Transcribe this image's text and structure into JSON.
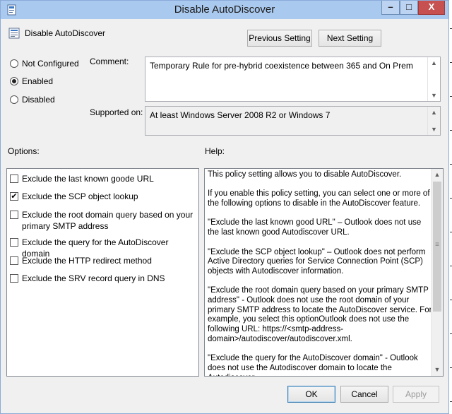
{
  "window": {
    "title": "Disable AutoDiscover",
    "minimize_glyph": "–",
    "maximize_glyph": "□",
    "close_glyph": "X"
  },
  "header": {
    "policy_title": "Disable AutoDiscover",
    "previous_label": "Previous Setting",
    "next_label": "Next Setting"
  },
  "state": {
    "options": [
      {
        "label": "Not Configured",
        "selected": false
      },
      {
        "label": "Enabled",
        "selected": true
      },
      {
        "label": "Disabled",
        "selected": false
      }
    ]
  },
  "comment": {
    "label": "Comment:",
    "value": "Temporary Rule for pre-hybrid coexistence between 365 and On Prem"
  },
  "supported": {
    "label": "Supported on:",
    "value": "At least Windows Server 2008 R2 or Windows 7"
  },
  "options_label": "Options:",
  "help_label": "Help:",
  "options": [
    {
      "label": "Exclude the last known goode URL",
      "checked": false
    },
    {
      "label": "Exclude the SCP object lookup",
      "checked": true
    },
    {
      "label": "Exclude the root domain query based on your primary SMTP address",
      "checked": false
    },
    {
      "label": "Exclude the query for the AutoDiscover domain",
      "checked": false
    },
    {
      "label": "Exclude the HTTP redirect method",
      "checked": false
    },
    {
      "label": "Exclude the SRV record query in DNS",
      "checked": false
    }
  ],
  "help": {
    "paragraphs": [
      "This policy setting allows you to disable AutoDiscover.",
      "If you enable this policy setting, you can select one or more of the following options to disable in the AutoDiscover feature.",
      "\"Exclude the last known good URL\" – Outlook does not use the last known good Autodiscover URL.",
      "\"Exclude the SCP object lookup\" – Outlook does not perform Active Directory queries for Service Connection Point (SCP) objects with Autodiscover information.",
      "\"Exclude the root domain query based on your primary SMTP address\" - Outlook does not use the root domain of your primary SMTP address to locate the AutoDiscover service. For example, you select this optionOutlook does not use the following URL: https://<smtp-address-domain>/autodiscover/autodiscover.xml.",
      "\"Exclude the query for the AutoDiscover domain\" - Outlook does not use the Autodiscover domain to locate the Autodiscover"
    ]
  },
  "footer": {
    "ok_label": "OK",
    "cancel_label": "Cancel",
    "apply_label": "Apply"
  },
  "scroll_glyphs": {
    "up": "▲",
    "down": "▼",
    "grip": "≡"
  }
}
